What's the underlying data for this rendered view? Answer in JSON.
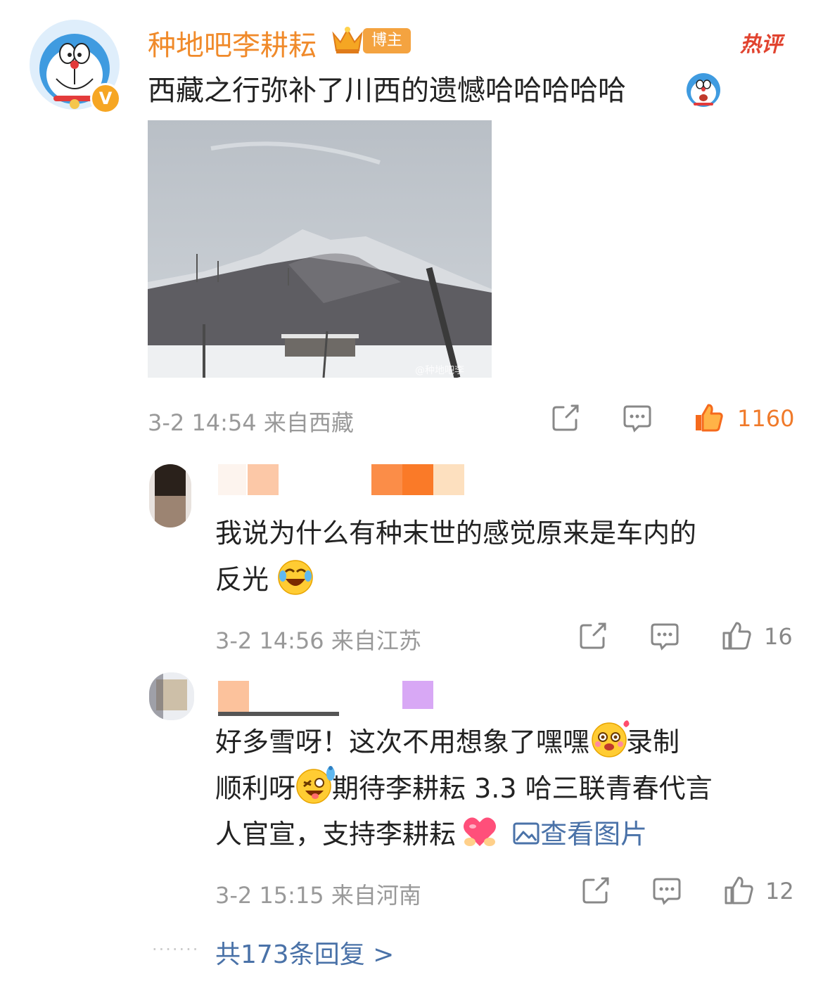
{
  "post": {
    "username": "种地吧李耕耘",
    "badge_label": "博主",
    "hot_label": "热评",
    "text": "西藏之行弥补了川西的遗憾哈哈哈哈哈",
    "photo_watermark": "@种地吧李",
    "meta": "3-2 14:54  来自西藏",
    "like_count": "1160"
  },
  "replies": [
    {
      "line1": "我说为什么有种末世的感觉原来是车内的",
      "line2": "反光",
      "meta": "3-2 14:56  来自江苏",
      "like_count": "16"
    },
    {
      "line1a": "好多雪呀！这次不用想象了嘿嘿",
      "line1b": "录制",
      "line2a": "顺利呀",
      "line2b": "期待李耕耘 3.3 哈三联青春代言",
      "line3a": "人官宣，支持李耕耘",
      "view_image": "查看图片",
      "meta": "3-2 15:15  来自河南",
      "like_count": "12"
    }
  ],
  "more_replies": "共173条回复 >",
  "colors": {
    "username": "#f08a2a",
    "hot": "#e1432f",
    "link": "#4a72a8",
    "like_active": "#f07a2a"
  },
  "icons": [
    "share-icon",
    "comment-icon",
    "like-icon",
    "image-icon"
  ]
}
